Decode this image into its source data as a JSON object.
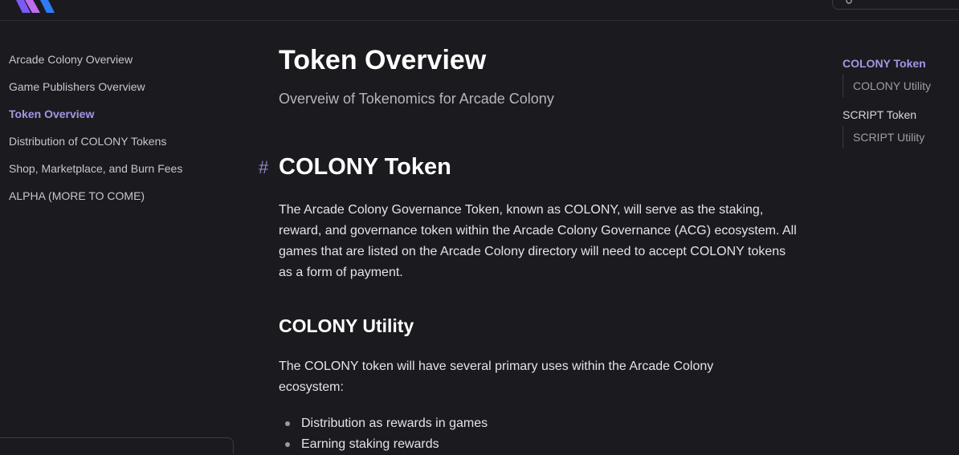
{
  "sidebar": {
    "items": [
      {
        "label": "Arcade Colony Overview"
      },
      {
        "label": "Game Publishers Overview"
      },
      {
        "label": "Token Overview"
      },
      {
        "label": "Distribution of COLONY Tokens"
      },
      {
        "label": "Shop, Marketplace, and Burn Fees"
      },
      {
        "label": "ALPHA (MORE TO COME)"
      }
    ],
    "active_index": 2
  },
  "main": {
    "title": "Token Overview",
    "subtitle": "Overveiw of Tokenomics for Arcade Colony",
    "anchor_symbol": "#",
    "section_title": "COLONY Token",
    "section_paragraph": "The Arcade Colony Governance Token, known as COLONY, will serve as the staking, reward, and governance token within the Arcade Colony Governance (ACG) ecosystem. All games that are listed on the Arcade Colony directory will need to accept COLONY tokens as a form of payment.",
    "subsection_title": "COLONY Utility",
    "subsection_paragraph": "The COLONY token will have several primary uses within the Arcade Colony ecosystem:",
    "bullets": [
      "Distribution as rewards in games",
      "Earning staking rewards"
    ]
  },
  "outline": {
    "items": [
      {
        "label": "COLONY Token",
        "sub": "COLONY Utility"
      },
      {
        "label": "SCRIPT Token",
        "sub": "SCRIPT Utility"
      }
    ]
  },
  "colors": {
    "background": "#1b1b1f",
    "accent": "#a596e6",
    "text": "#dfdfe3"
  },
  "icons": {
    "logo": "arcade-colony-logo",
    "search": "search-icon"
  }
}
